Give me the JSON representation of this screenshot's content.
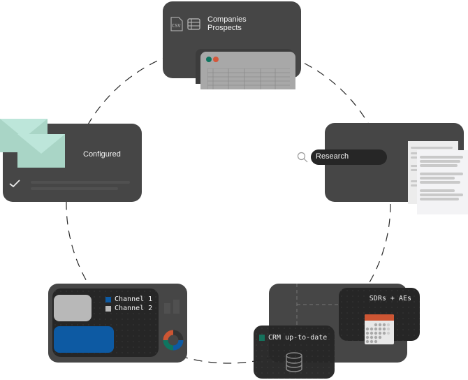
{
  "diagram": {
    "type": "cycle",
    "nodes": {
      "import": {
        "icons": [
          "csv-file-icon",
          "table-icon"
        ],
        "lines": [
          "Companies",
          "Prospects"
        ],
        "window_dots": [
          "#0e7560",
          "#d4573a"
        ]
      },
      "research": {
        "search_label": "Research",
        "icon": "search-icon"
      },
      "route": {
        "label": "SDRs + AEs",
        "icon": "calendar-icon",
        "accent": "#cc5533"
      },
      "crm": {
        "label": "CRM up-to-date",
        "icon": "database-icon",
        "status_color": "#0e6e57"
      },
      "channels": {
        "legend": [
          {
            "label": "Channel 1",
            "color": "#0d5aa3"
          },
          {
            "label": "Channel 2",
            "color": "#b8b8b8"
          }
        ],
        "donut_colors": [
          "#cc5533",
          "#3b3b3b",
          "#0d5aa3",
          "#0e7560"
        ]
      },
      "configured": {
        "label": "Configured",
        "icon": "check-icon",
        "envelope_color": "#a9d5c6"
      }
    }
  }
}
